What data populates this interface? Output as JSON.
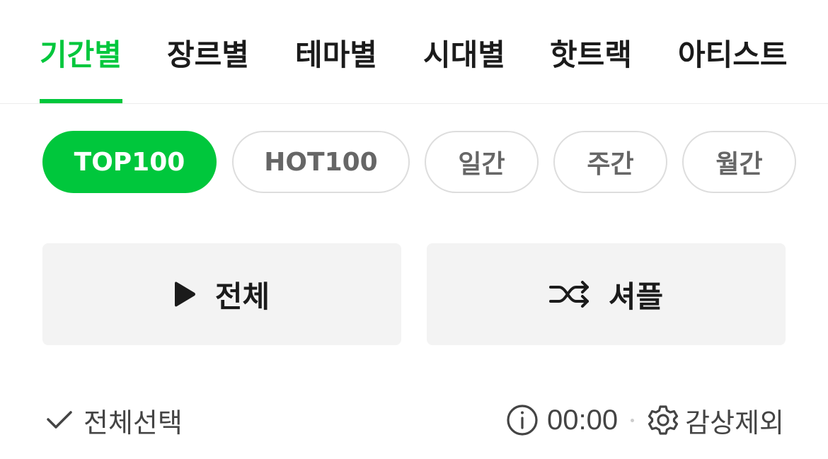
{
  "tabs": [
    {
      "label": "기간별",
      "active": true
    },
    {
      "label": "장르별",
      "active": false
    },
    {
      "label": "테마별",
      "active": false
    },
    {
      "label": "시대별",
      "active": false
    },
    {
      "label": "핫트랙",
      "active": false
    },
    {
      "label": "아티스트",
      "active": false
    }
  ],
  "chips": [
    {
      "label": "TOP100",
      "active": true
    },
    {
      "label": "HOT100",
      "active": false
    },
    {
      "label": "일간",
      "active": false
    },
    {
      "label": "주간",
      "active": false
    },
    {
      "label": "월간",
      "active": false
    }
  ],
  "actions": {
    "play_all_label": "전체",
    "play_all_icon": "play-icon",
    "shuffle_label": "셔플",
    "shuffle_icon": "shuffle-icon"
  },
  "bottom_bar": {
    "select_all_label": "전체선택",
    "select_all_icon": "check-icon",
    "info_icon": "info-icon",
    "duration": "00:00",
    "settings_icon": "gear-icon",
    "exclude_label": "감상제외"
  },
  "colors": {
    "accent": "#00c73c",
    "text": "#1b1b1b",
    "muted_text": "#444444",
    "chip_text": "#666666",
    "button_bg": "#f3f3f3"
  }
}
